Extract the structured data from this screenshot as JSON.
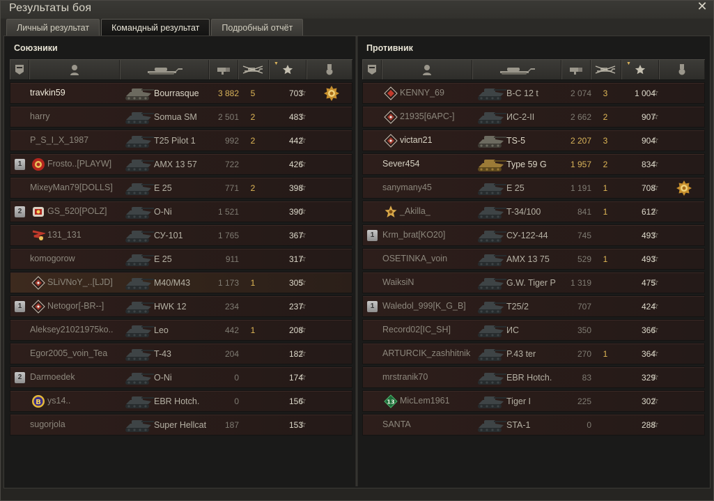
{
  "window": {
    "title": "Результаты боя",
    "close": "✕"
  },
  "tabs": [
    {
      "label": "Личный результат",
      "active": false
    },
    {
      "label": "Командный результат",
      "active": true
    },
    {
      "label": "Подробный отчёт",
      "active": false
    }
  ],
  "allies": {
    "title": "Союзники",
    "players": [
      {
        "name": "travkin59",
        "vehicle": "Bourrasque",
        "damage": "3 882",
        "frags": "5",
        "xp": "703",
        "self": true,
        "alive": true,
        "medal": "gold-medal-icon"
      },
      {
        "name": "harry",
        "vehicle": "Somua SM",
        "damage": "2 501",
        "frags": "2",
        "xp": "483"
      },
      {
        "name": "P_S_I_X_1987",
        "vehicle": "T25 Pilot 1",
        "damage": "992",
        "frags": "2",
        "xp": "442"
      },
      {
        "name": "Frosto..[PLAYW]",
        "vehicle": "AMX 13 57",
        "damage": "722",
        "frags": "",
        "xp": "426",
        "squad": "1",
        "badge": "red-clan-icon"
      },
      {
        "name": "MixeyMan79[DOLLS]",
        "vehicle": "E 25",
        "damage": "771",
        "frags": "2",
        "xp": "398"
      },
      {
        "name": "GS_520[POLZ]",
        "vehicle": "O-Ni",
        "damage": "1 521",
        "frags": "",
        "xp": "390",
        "squad": "2",
        "badge": "clan-emblem-icon"
      },
      {
        "name": "131_131",
        "vehicle": "СУ-101",
        "damage": "1 765",
        "frags": "",
        "xp": "367",
        "badge": "flag-emblem-icon"
      },
      {
        "name": "komogorow",
        "vehicle": "E 25",
        "damage": "911",
        "frags": "",
        "xp": "317"
      },
      {
        "name": "SLiVNoY_..[LJD]",
        "vehicle": "M40/M43",
        "damage": "1 173",
        "frags": "1",
        "xp": "305",
        "badge": "diamond-clan-icon",
        "highlight": true
      },
      {
        "name": "Netogor[-BR--]",
        "vehicle": "HWK 12",
        "damage": "234",
        "frags": "",
        "xp": "237",
        "squad": "1",
        "badge": "diamond-clan-icon"
      },
      {
        "name": "Aleksey21021975ko..",
        "vehicle": "Leo",
        "damage": "442",
        "frags": "1",
        "xp": "208"
      },
      {
        "name": "Egor2005_voin_Tea",
        "vehicle": "T-43",
        "damage": "204",
        "frags": "",
        "xp": "182"
      },
      {
        "name": "Darmoedek",
        "vehicle": "O-Ni",
        "damage": "0",
        "frags": "",
        "xp": "174",
        "squad": "2"
      },
      {
        "name": "ys14..",
        "vehicle": "EBR Hotch.",
        "damage": "0",
        "frags": "",
        "xp": "156",
        "badge": "b-clan-icon"
      },
      {
        "name": "sugorjola",
        "vehicle": "Super Hellcat",
        "damage": "187",
        "frags": "",
        "xp": "153"
      }
    ]
  },
  "enemies": {
    "title": "Противник",
    "players": [
      {
        "name": "KENNY_69",
        "vehicle": "B-C 12 t",
        "damage": "2 074",
        "frags": "3",
        "xp": "1 004",
        "badge": "red-diamond-icon"
      },
      {
        "name": "21935[6APC-]",
        "vehicle": "ИС-2-II",
        "damage": "2 662",
        "frags": "2",
        "xp": "907",
        "badge": "diamond-clan-icon"
      },
      {
        "name": "victan21",
        "vehicle": "TS-5",
        "damage": "2 207",
        "frags": "3",
        "xp": "904",
        "alive": true,
        "badge": "diamond-clan-icon"
      },
      {
        "name": "Sever454",
        "vehicle": "Type 59 G",
        "damage": "1 957",
        "frags": "2",
        "xp": "834",
        "alive": true
      },
      {
        "name": "sanymany45",
        "vehicle": "E 25",
        "damage": "1 191",
        "frags": "1",
        "xp": "708",
        "medal": "gold-medal-icon"
      },
      {
        "name": "_Akilla_",
        "vehicle": "T-34/100",
        "damage": "841",
        "frags": "1",
        "xp": "612",
        "badge": "gold-emblem-icon"
      },
      {
        "name": "Krm_brat[KO20]",
        "vehicle": "СУ-122-44",
        "damage": "745",
        "frags": "",
        "xp": "493",
        "squad": "1"
      },
      {
        "name": "OSETINKA_voin",
        "vehicle": "AMX 13 75",
        "damage": "529",
        "frags": "1",
        "xp": "493"
      },
      {
        "name": "WaiksiN",
        "vehicle": "G.W. Tiger P",
        "damage": "1 319",
        "frags": "",
        "xp": "475"
      },
      {
        "name": "Waledol_999[K_G_B]",
        "vehicle": "T25/2",
        "damage": "707",
        "frags": "",
        "xp": "424",
        "squad": "1"
      },
      {
        "name": "Record02[IC_SH]",
        "vehicle": "ИС",
        "damage": "350",
        "frags": "",
        "xp": "366"
      },
      {
        "name": "ARTURCIK_zashhitnik",
        "vehicle": "P.43 ter",
        "damage": "270",
        "frags": "1",
        "xp": "364"
      },
      {
        "name": "mrstranik70",
        "vehicle": "EBR Hotch.",
        "damage": "83",
        "frags": "",
        "xp": "329"
      },
      {
        "name": "MicLem1961",
        "vehicle": "Tiger I",
        "damage": "225",
        "frags": "",
        "xp": "302",
        "badge": "green-13-icon"
      },
      {
        "name": "SANTA",
        "vehicle": "STA-1",
        "damage": "0",
        "frags": "",
        "xp": "288"
      }
    ]
  },
  "columns": {
    "squad": "squad-icon",
    "player": "player-icon",
    "vehicle": "tank-icon",
    "damage": "damage-icon",
    "frags": "frags-icon",
    "xp": "experience-star-icon",
    "medal": "medal-icon"
  },
  "colors": {
    "damage_hi": "#d8b35a",
    "frags": "#e0b856",
    "row_bg": "#2a1c19"
  }
}
